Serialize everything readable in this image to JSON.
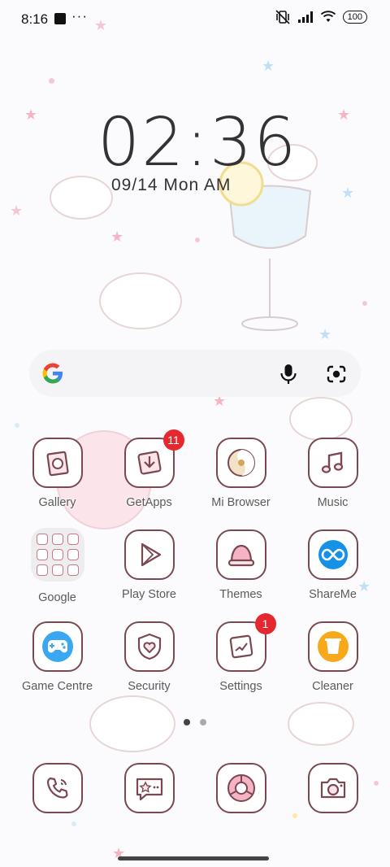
{
  "status_bar": {
    "time": "8:16",
    "dots": "···",
    "battery": "100"
  },
  "clock": {
    "time": "02:36",
    "date": "09/14 Mon AM"
  },
  "search_bar": {
    "google_icon": "google-logo",
    "mic_icon": "mic-icon",
    "lens_icon": "lens-icon"
  },
  "apps": {
    "row1": [
      {
        "label": "Gallery",
        "icon": "gallery-icon"
      },
      {
        "label": "GetApps",
        "icon": "getapps-icon",
        "badge": "11"
      },
      {
        "label": "Mi Browser",
        "icon": "browser-icon"
      },
      {
        "label": "Music",
        "icon": "music-icon"
      }
    ],
    "row2": [
      {
        "label": "Google",
        "icon": "folder-icon"
      },
      {
        "label": "Play Store",
        "icon": "play-store-icon"
      },
      {
        "label": "Themes",
        "icon": "themes-icon"
      },
      {
        "label": "ShareMe",
        "icon": "shareme-icon"
      }
    ],
    "row3": [
      {
        "label": "Game Centre",
        "icon": "game-centre-icon"
      },
      {
        "label": "Security",
        "icon": "security-icon"
      },
      {
        "label": "Settings",
        "icon": "settings-icon",
        "badge": "1"
      },
      {
        "label": "Cleaner",
        "icon": "cleaner-icon"
      }
    ]
  },
  "pager": {
    "pages": 2,
    "current": 1
  },
  "dock": [
    "phone-icon",
    "messaging-icon",
    "chrome-icon",
    "camera-icon"
  ],
  "colors": {
    "tile_border": "#7a4850",
    "badge": "#e5282f",
    "accent_pink": "#f5b7c3"
  }
}
